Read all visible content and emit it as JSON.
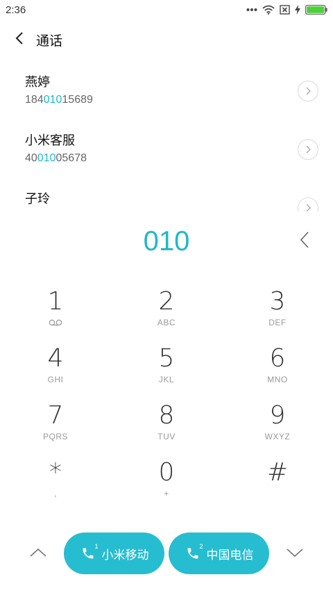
{
  "status_bar": {
    "time": "2:36",
    "icons": [
      "more-dots-icon",
      "wifi-icon",
      "no-sim-icon",
      "charging-bolt-icon",
      "battery-icon"
    ],
    "battery_color": "#4cd137"
  },
  "header": {
    "title": "通话",
    "back_icon": "chevron-left-icon"
  },
  "contacts": [
    {
      "name": "燕婷",
      "number_pre": "184",
      "number_match": "010",
      "number_post": "15689"
    },
    {
      "name": "小米客服",
      "number_pre": "40",
      "number_match": "010",
      "number_post": "05678"
    },
    {
      "name": "子玲",
      "number_pre": "",
      "number_match": "",
      "number_post": ""
    }
  ],
  "dialer": {
    "input": "010",
    "backspace_icon": "backspace-chevron-icon"
  },
  "keypad": [
    {
      "digit": "1",
      "sub": "",
      "sub_icon": "voicemail-icon"
    },
    {
      "digit": "2",
      "sub": "ABC"
    },
    {
      "digit": "3",
      "sub": "DEF"
    },
    {
      "digit": "4",
      "sub": "GHI"
    },
    {
      "digit": "5",
      "sub": "JKL"
    },
    {
      "digit": "6",
      "sub": "MNO"
    },
    {
      "digit": "7",
      "sub": "PQRS"
    },
    {
      "digit": "8",
      "sub": "TUV"
    },
    {
      "digit": "9",
      "sub": "WXYZ"
    },
    {
      "digit": "*",
      "sub": ","
    },
    {
      "digit": "0",
      "sub": "+"
    },
    {
      "digit": "#",
      "sub": ""
    }
  ],
  "bottom": {
    "sim1": {
      "label": "小米移动",
      "slot": "1"
    },
    "sim2": {
      "label": "中国电信",
      "slot": "2"
    },
    "accent": "#27bdd0",
    "highlight": "#1fb8cc"
  }
}
